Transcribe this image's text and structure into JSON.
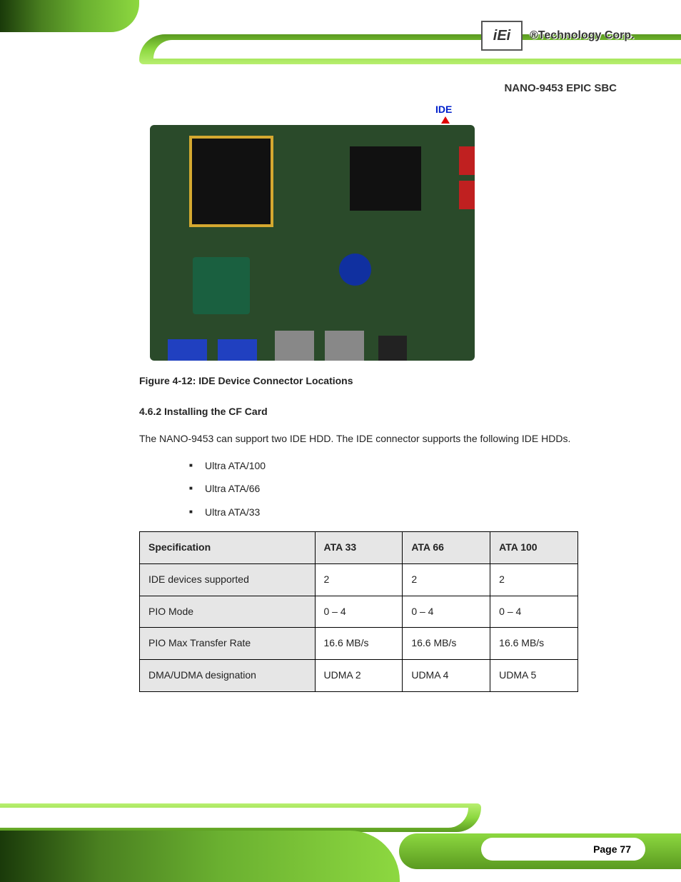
{
  "header": {
    "logo_text": "iEi",
    "company_text": "®Technology Corp.",
    "product_name": "NANO-9453 EPIC SBC"
  },
  "figure": {
    "ide_label": "IDE",
    "caption": "Figure 4-12: IDE Device Connector Locations"
  },
  "body": {
    "section_title": "4.6.2 Installing the CF Card",
    "intro": "The NANO-9453 can support two IDE HDD. The IDE connector supports the following IDE HDDs.",
    "bullets": [
      "Ultra ATA/100",
      "Ultra ATA/66",
      "Ultra ATA/33"
    ],
    "table": {
      "headers": [
        "Specification",
        "ATA 33",
        "ATA 66",
        "ATA 100"
      ],
      "rows": [
        {
          "label": "IDE devices supported",
          "c1": "2",
          "c2": "2",
          "c3": "2"
        },
        {
          "label": "PIO Mode",
          "c1": "0 – 4",
          "c2": "0 – 4",
          "c3": "0 – 4"
        },
        {
          "label": "PIO Max Transfer Rate",
          "c1": "16.6 MB/s",
          "c2": "16.6 MB/s",
          "c3": "16.6 MB/s"
        },
        {
          "label": "DMA/UDMA designation",
          "c1": "UDMA 2",
          "c2": "UDMA 4",
          "c3": "UDMA 5"
        }
      ]
    }
  },
  "footer": {
    "page_number": "Page 77"
  }
}
